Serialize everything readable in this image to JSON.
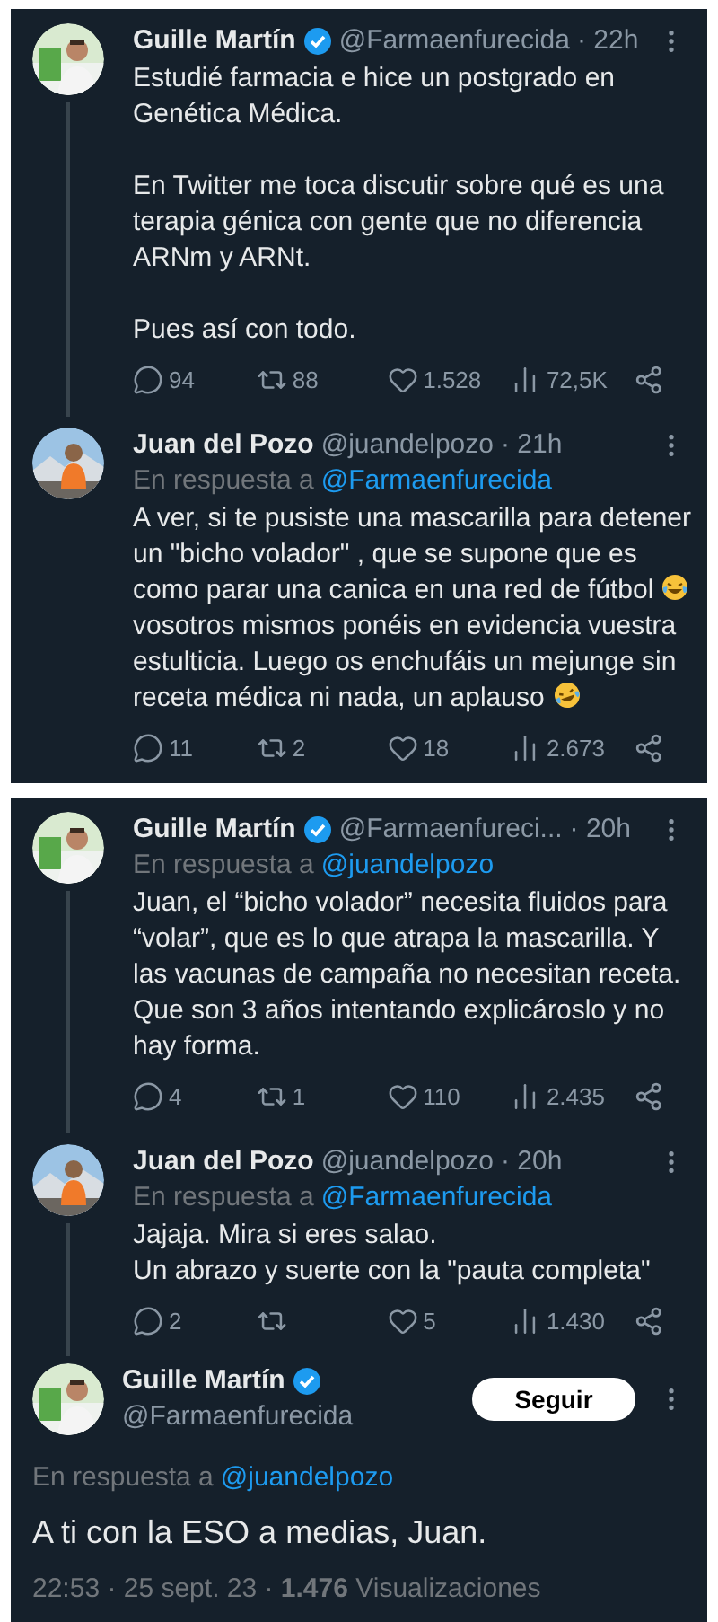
{
  "panels": [
    {
      "tweets": [
        {
          "name": "Guille Martín",
          "verified": true,
          "handle": "@Farmaenfurecida",
          "meta": "· 22h",
          "thread_after": true,
          "body": [
            [
              {
                "kind": "text",
                "text": "Estudié farmacia e hice un postgrado en\nGenética Médica."
              }
            ],
            [
              {
                "kind": "text",
                "text": "En Twitter me toca discutir sobre qué es una\nterapia génica con gente que no diferencia\nARNm y ARNt."
              }
            ],
            [
              {
                "kind": "text",
                "text": "Pues así con todo."
              }
            ]
          ],
          "stats": {
            "replies": "94",
            "retweets": "88",
            "likes": "1.528",
            "views": "72,5K"
          }
        },
        {
          "name": "Juan del Pozo",
          "verified": false,
          "handle": "@juandelpozo",
          "meta": "· 21h",
          "thread_after": false,
          "reply_to": {
            "prefix": "En respuesta a",
            "handle": "@Farmaenfurecida"
          },
          "body": [
            [
              {
                "kind": "text",
                "text": "A ver, si te pusiste una mascarilla para detener\nun \"bicho volador\" , que se supone que es\ncomo parar una canica en una red de fútbol "
              },
              {
                "kind": "tears-emoji"
              },
              {
                "kind": "text",
                "text": "\nvosotros mismos ponéis en evidencia vuestra\nestulticia. Luego os enchufáis un mejunge sin\nreceta médica ni nada, un aplauso "
              },
              {
                "kind": "rofl-emoji"
              }
            ]
          ],
          "stats": {
            "replies": "11",
            "retweets": "2",
            "likes": "18",
            "views": "2.673"
          }
        }
      ]
    },
    {
      "tweets": [
        {
          "name": "Guille Martín",
          "verified": true,
          "handle": "@Farmaenfureci...",
          "meta": " · 20h",
          "thread_after": true,
          "reply_to": {
            "prefix": "En respuesta a",
            "handle": "@juandelpozo"
          },
          "body": [
            [
              {
                "kind": "text",
                "text": "Juan, el “bicho volador” necesita fluidos para\n“volar”, que es lo que atrapa la mascarilla. Y\nlas vacunas de campaña no necesitan receta.\nQue son 3 años intentando explicároslo y no\nhay forma."
              }
            ]
          ],
          "stats": {
            "replies": "4",
            "retweets": "1",
            "likes": "110",
            "views": "2.435"
          }
        },
        {
          "name": "Juan del Pozo",
          "verified": false,
          "handle": "@juandelpozo",
          "meta": "· 20h",
          "thread_after": true,
          "reply_to": {
            "prefix": "En respuesta a",
            "handle": "@Farmaenfurecida"
          },
          "body": [
            [
              {
                "kind": "text",
                "text": "Jajaja. Mira si eres salao.\nUn abrazo y suerte con la \"pauta completa\""
              }
            ]
          ],
          "stats": {
            "replies": "2",
            "likes": "5",
            "views": "1.430"
          }
        }
      ],
      "main": {
        "name": "Guille Martín",
        "verified": true,
        "handle": "@Farmaenfurecida",
        "follow": "Seguir",
        "reply_to": {
          "prefix": "En respuesta a",
          "handle": "@juandelpozo"
        },
        "text": "A ti con la ESO a medias, Juan.",
        "footer": "22:53 · 25 sept. 23 · **1.476** Visualizaciones"
      }
    }
  ]
}
